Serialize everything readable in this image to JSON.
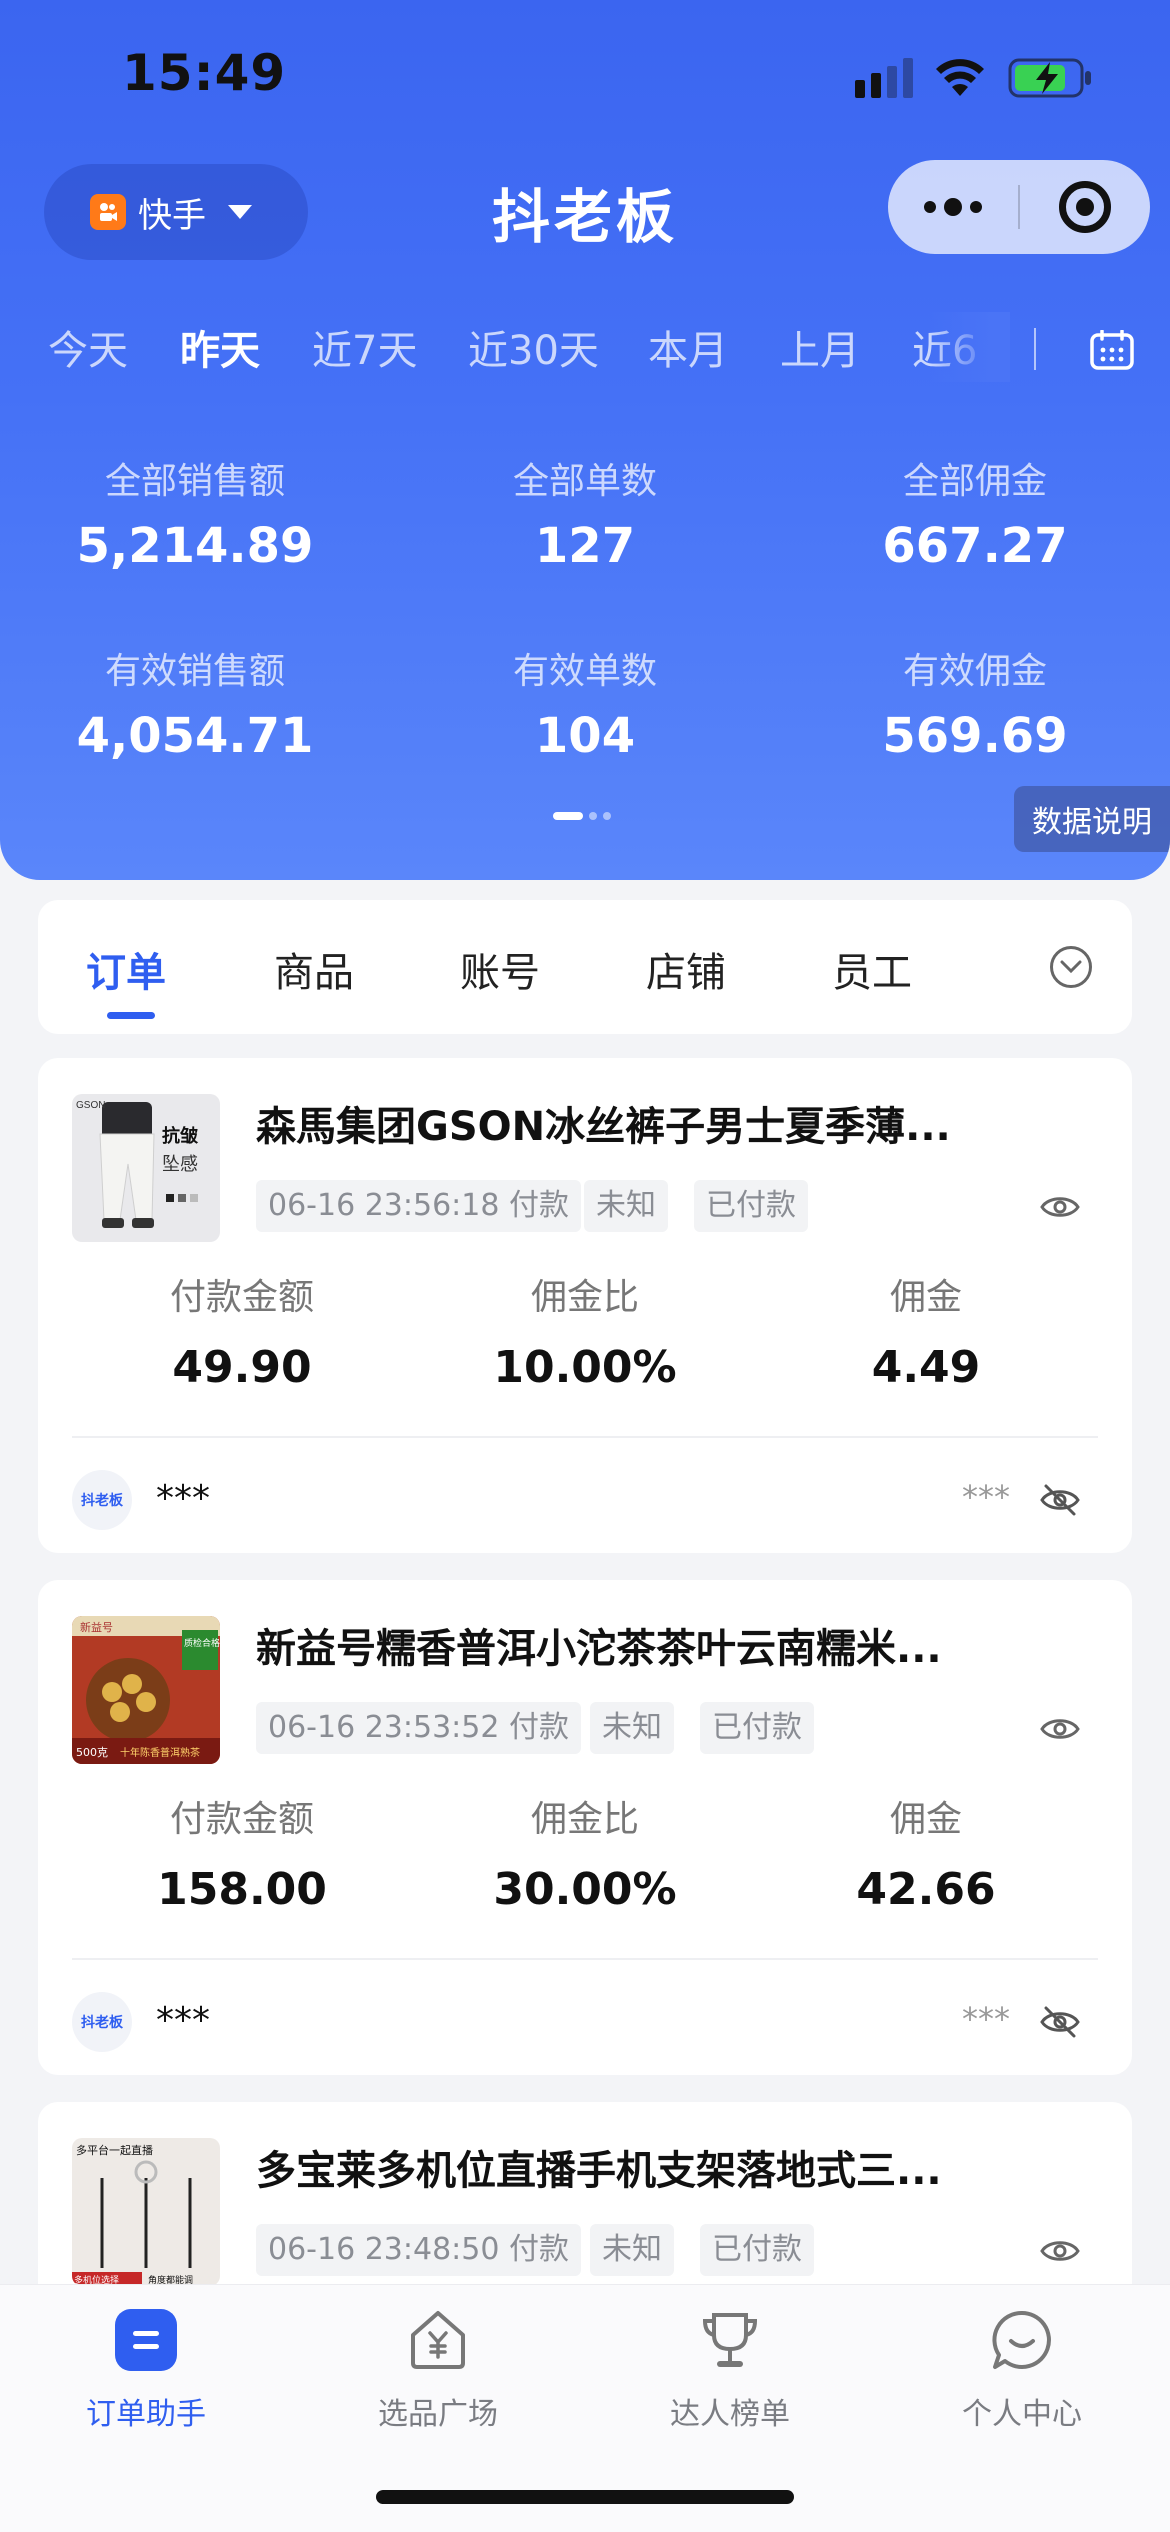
{
  "status_bar": {
    "time": "15:49"
  },
  "header": {
    "platform": "快手",
    "app_title": "抖老板"
  },
  "date_tabs": [
    "今天",
    "昨天",
    "近7天",
    "近30天",
    "本月",
    "上月",
    "近6"
  ],
  "active_date_tab": "昨天",
  "stats": [
    {
      "label": "全部销售额",
      "value": "5,214.89"
    },
    {
      "label": "全部单数",
      "value": "127"
    },
    {
      "label": "全部佣金",
      "value": "667.27"
    },
    {
      "label": "有效销售额",
      "value": "4,054.71"
    },
    {
      "label": "有效单数",
      "value": "104"
    },
    {
      "label": "有效佣金",
      "value": "569.69"
    }
  ],
  "data_explain": "数据说明",
  "nav_tabs": [
    "订单",
    "商品",
    "账号",
    "店铺",
    "员工"
  ],
  "active_nav_tab": "订单",
  "orders": [
    {
      "title": "森馬集团GSON冰丝裤子男士夏季薄...",
      "time_tag": "06-16 23:56:18 付款",
      "status_tag_1": "未知",
      "status_tag_2": "已付款",
      "metrics": [
        {
          "label": "付款金额",
          "value": "49.90"
        },
        {
          "label": "佣金比",
          "value": "10.00%"
        },
        {
          "label": "佣金",
          "value": "4.49"
        }
      ],
      "account_logo": "抖老板",
      "account_name": "***",
      "account_mask": "***",
      "thumb_texts": [
        "GSON",
        "抗皱",
        "坠感"
      ]
    },
    {
      "title": "新益号糯香普洱小沱茶茶叶云南糯米...",
      "time_tag": "06-16 23:53:52 付款",
      "status_tag_1": "未知",
      "status_tag_2": "已付款",
      "metrics": [
        {
          "label": "付款金额",
          "value": "158.00"
        },
        {
          "label": "佣金比",
          "value": "30.00%"
        },
        {
          "label": "佣金",
          "value": "42.66"
        }
      ],
      "account_logo": "抖老板",
      "account_name": "***",
      "account_mask": "***",
      "thumb_texts": [
        "新益号",
        "质检合格",
        "500克",
        "十年陈香普洱熟茶"
      ]
    },
    {
      "title": "多宝莱多机位直播手机支架落地式三...",
      "time_tag": "06-16 23:48:50 付款",
      "status_tag_1": "未知",
      "status_tag_2": "已付款",
      "thumb_texts": [
        "多平台一起直播",
        "多机位选择",
        "角度都能调"
      ]
    }
  ],
  "bottom_nav": [
    {
      "label": "订单助手",
      "icon": "order-assistant-icon",
      "active": true
    },
    {
      "label": "选品广场",
      "icon": "product-plaza-icon",
      "active": false
    },
    {
      "label": "达人榜单",
      "icon": "trophy-icon",
      "active": false
    },
    {
      "label": "个人中心",
      "icon": "chat-smile-icon",
      "active": false
    }
  ],
  "colors": {
    "primary": "#2f5ef0",
    "hero_top": "#3b65f0",
    "hero_bottom": "#5a86fa",
    "platform_orange": "#ff7a18"
  }
}
